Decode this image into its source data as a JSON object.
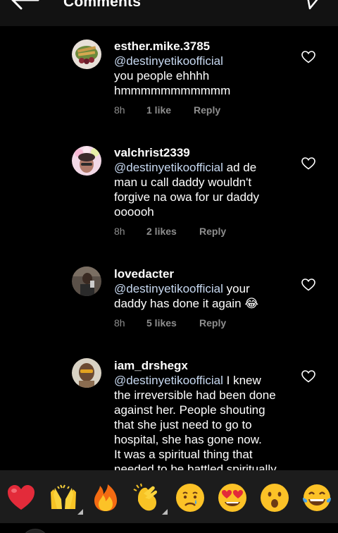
{
  "header": {
    "title": "Comments"
  },
  "comments": [
    {
      "username": "esther.mike.3785",
      "mention": "@destinyetikoofficial",
      "text_lines_after": [
        "you people ehhhh",
        "hmmmmmmmmmmm"
      ],
      "time": "8h",
      "likes": "1 like",
      "reply": "Reply"
    },
    {
      "username": "valchrist2339",
      "mention": "@destinyetikoofficial",
      "inline_after_mention": " ad de",
      "text_lines_after": [
        "man u call daddy wouldn't",
        "forgive na owa for ur daddy",
        "oooooh"
      ],
      "time": "8h",
      "likes": "2 likes",
      "reply": "Reply"
    },
    {
      "username": "lovedacter",
      "mention": "@destinyetikoofficial",
      "inline_after_mention": " your",
      "text_lines_after": [
        "daddy has done it again 😂"
      ],
      "time": "8h",
      "likes": "5 likes",
      "reply": "Reply"
    },
    {
      "username": "iam_drshegx",
      "mention": "@destinyetikoofficial",
      "inline_after_mention": " I knew",
      "text_lines_after": [
        "the irreversible had been done",
        "against her. People shouting",
        "that she just need to go to",
        "hospital, she has gone now.",
        "It was a spiritual thing that",
        "needed to be battled spiritually"
      ]
    }
  ],
  "emoji_bar": {
    "items": [
      "❤️",
      "🙌",
      "🔥",
      "👏",
      "😢",
      "😍",
      "😮",
      "😂"
    ]
  }
}
